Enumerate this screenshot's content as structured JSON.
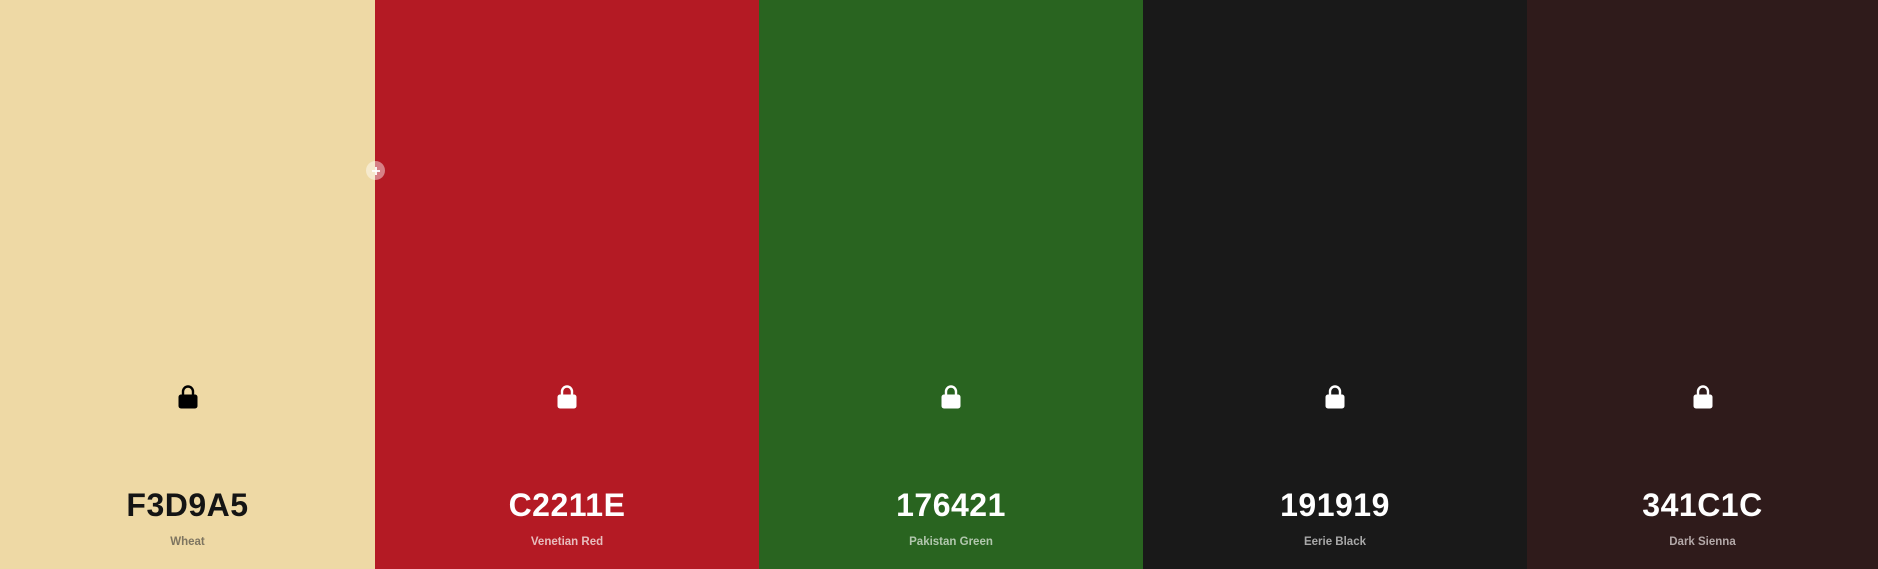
{
  "palette": {
    "colors": [
      {
        "hex": "F3D9A5",
        "name": "Wheat",
        "swatch": "#EED9A5",
        "text_color": "#141414",
        "name_color": "#7E7560",
        "lock_color": "#000000"
      },
      {
        "hex": "C2211E",
        "name": "Venetian Red",
        "swatch": "#B41A24",
        "text_color": "#FFFFFF",
        "name_color": "#E7BDBD",
        "lock_color": "#FFFFFF"
      },
      {
        "hex": "176421",
        "name": "Pakistan Green",
        "swatch": "#296420",
        "text_color": "#FFFFFF",
        "name_color": "#B2C7AE",
        "lock_color": "#FFFFFF"
      },
      {
        "hex": "191919",
        "name": "Eerie Black",
        "swatch": "#191919",
        "text_color": "#FFFFFF",
        "name_color": "#A8A8A8",
        "lock_color": "#FFFFFF"
      },
      {
        "hex": "341C1C",
        "name": "Dark Sienna",
        "swatch": "#2F1B1B",
        "text_color": "#FFFFFF",
        "name_color": "#B3A8A8",
        "lock_color": "#FFFFFF"
      }
    ],
    "lock_icon": "lock-icon",
    "add_icon": "plus-icon"
  }
}
